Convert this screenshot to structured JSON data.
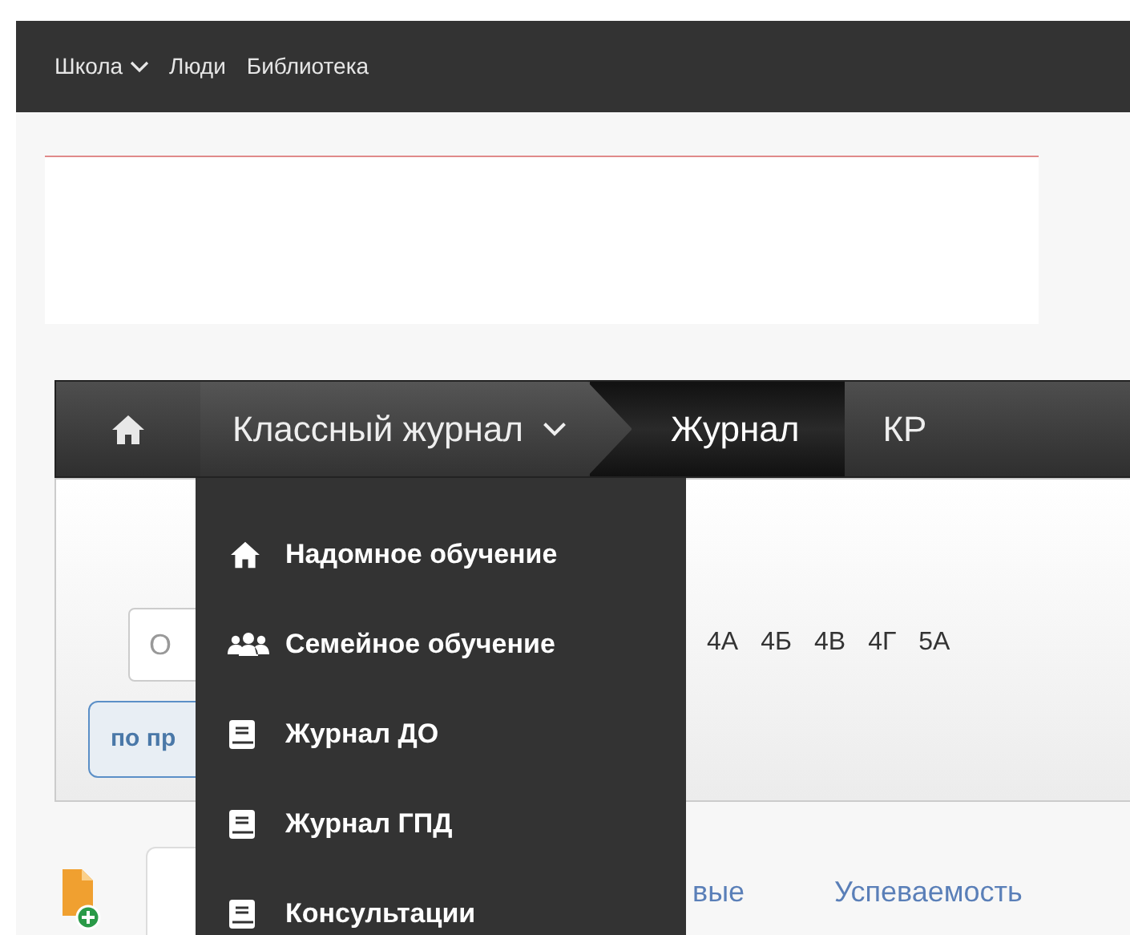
{
  "top_nav": [
    {
      "label": "Школа",
      "has_menu": true
    },
    {
      "label": "Люди",
      "has_menu": false
    },
    {
      "label": "Библиотека",
      "has_menu": false
    }
  ],
  "breadcrumb": [
    {
      "label": "Классный журнал",
      "kind": "dropdown",
      "selected": false
    },
    {
      "label": "Журнал",
      "kind": "link",
      "selected": true
    },
    {
      "label": "КР",
      "kind": "link",
      "selected": false
    }
  ],
  "dropdown_menu": [
    {
      "label": "Надомное обучение",
      "kind": "home"
    },
    {
      "label": "Семейное обучение",
      "kind": "people"
    },
    {
      "label": "Журнал ДО",
      "kind": "book"
    },
    {
      "label": "Журнал ГПД",
      "kind": "book"
    },
    {
      "label": "Консультации",
      "kind": "book"
    }
  ],
  "class_panel": {
    "search_value": "О",
    "classes": [
      "4А",
      "4Б",
      "4В",
      "4Г",
      "5А"
    ],
    "filter_button": "по пр"
  },
  "tabs": [
    {
      "selected": true
    },
    {
      "label": "вые",
      "selected": false
    },
    {
      "label": "Успеваемость",
      "selected": false
    }
  ]
}
